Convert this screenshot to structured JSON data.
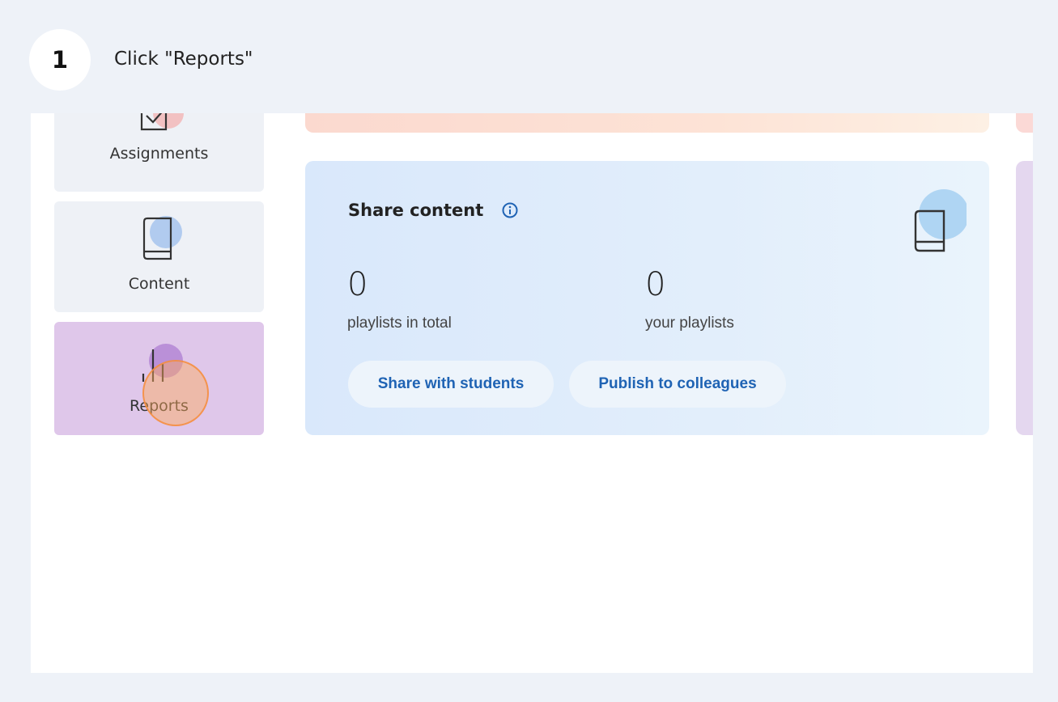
{
  "step": {
    "number": "1",
    "instruction": "Click \"Reports\""
  },
  "sidebar": {
    "items": [
      {
        "label": "Assignments",
        "icon": "assignment-check-icon",
        "accent": "#f2b8b8"
      },
      {
        "label": "Content",
        "icon": "book-icon",
        "accent": "#aac6ee"
      },
      {
        "label": "Reports",
        "icon": "bar-chart-icon",
        "accent": "#b68ad6",
        "active": true
      }
    ]
  },
  "share_card": {
    "title": "Share content",
    "info_icon": "info-icon",
    "stats": [
      {
        "value": "0",
        "label": "playlists in total"
      },
      {
        "value": "0",
        "label": "your playlists"
      }
    ],
    "buttons": {
      "share_students": "Share with students",
      "publish_colleagues": "Publish to colleagues"
    },
    "icon": "book-icon"
  },
  "colors": {
    "page_background": "#eef2f8",
    "card_background": "#eef1f6",
    "active_card": "#dfc7ea",
    "link_blue": "#1f63b4",
    "click_highlight": "#f59a4a"
  }
}
